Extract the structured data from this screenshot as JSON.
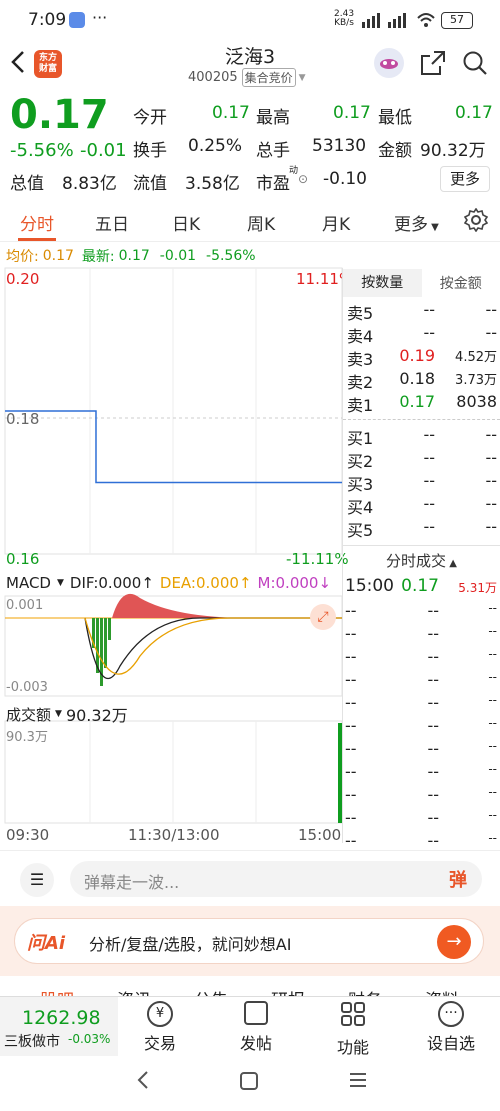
{
  "status_bar": {
    "time": "7:09",
    "net_speed_top": "2.43",
    "net_speed_bottom": "KB/s",
    "battery": "57",
    "dots": "···"
  },
  "header": {
    "logo_line1": "东方",
    "logo_line2": "财富",
    "title": "泛海3",
    "code": "400205",
    "mode": "集合竞价"
  },
  "quote": {
    "price": "0.17",
    "change_pct": "-5.56%",
    "change": "-0.01",
    "open_label": "今开",
    "open": "0.17",
    "high_label": "最高",
    "high": "0.17",
    "low_label": "最低",
    "low": "0.17",
    "turnover_label": "换手",
    "turnover": "0.25%",
    "volume_label": "总手",
    "volume": "53130",
    "amount_label": "金额",
    "amount": "90.32万",
    "mktcap_label": "总值",
    "mktcap": "8.83亿",
    "float_label": "流值",
    "float": "3.58亿",
    "pe_label": "市盈",
    "pe_sup": "动",
    "pe": "-0.10",
    "more": "更多"
  },
  "tabs": [
    "分时",
    "五日",
    "日K",
    "周K",
    "月K",
    "更多"
  ],
  "tab_settings_icon": "gear-icon",
  "info_line": {
    "avg_label": "均价:",
    "avg": "0.17",
    "latest_label": "最新:",
    "latest": "0.17",
    "change": "-0.01",
    "change_pct": "-5.56%"
  },
  "chart_data": [
    {
      "type": "line",
      "title": "分时",
      "y_top_label": "0.20",
      "y_top_pct": "11.11%",
      "y_mid_label": "0.18",
      "y_bottom_label": "0.16",
      "y_bottom_pct": "-11.11%",
      "ylim": [
        0.16,
        0.2
      ],
      "x_labels": [
        "09:30",
        "11:30/13:00",
        "15:00"
      ],
      "series": [
        {
          "values": [
            [
              0,
              0.18
            ],
            [
              0.27,
              0.18
            ],
            [
              0.27,
              0.17
            ],
            [
              1.0,
              0.17
            ]
          ],
          "color": "#2f6fd6"
        }
      ]
    },
    {
      "type": "bar",
      "title": "MACD",
      "dif": "DIF:0.000",
      "dea": "DEA:0.000",
      "m": "M:0.000",
      "y_top": "0.001",
      "y_bottom": "-0.003",
      "ylim": [
        -0.003,
        0.001
      ]
    },
    {
      "type": "bar",
      "title": "成交额",
      "value_label": "90.32万",
      "y_top": "90.3万",
      "bars": [
        {
          "x": 1.0,
          "value": 90.32,
          "color": "#0f9d1f"
        }
      ]
    }
  ],
  "orderbook": {
    "tab_qty": "按数量",
    "tab_amt": "按金额",
    "asks": [
      {
        "label": "卖5",
        "price": "--",
        "vol": "--"
      },
      {
        "label": "卖4",
        "price": "--",
        "vol": "--"
      },
      {
        "label": "卖3",
        "price": "0.19",
        "vol": "4.52万"
      },
      {
        "label": "卖2",
        "price": "0.18",
        "vol": "3.73万"
      },
      {
        "label": "卖1",
        "price": "0.17",
        "vol": "8038"
      }
    ],
    "bids": [
      {
        "label": "买1",
        "price": "--",
        "vol": "--"
      },
      {
        "label": "买2",
        "price": "--",
        "vol": "--"
      },
      {
        "label": "买3",
        "price": "--",
        "vol": "--"
      },
      {
        "label": "买4",
        "price": "--",
        "vol": "--"
      },
      {
        "label": "买5",
        "price": "--",
        "vol": "--"
      }
    ]
  },
  "ticks": {
    "title": "分时成交",
    "rows": [
      {
        "time": "15:00",
        "price": "0.17",
        "vol": "5.31万"
      },
      {
        "time": "--",
        "price": "--",
        "vol": "--"
      },
      {
        "time": "--",
        "price": "--",
        "vol": "--"
      },
      {
        "time": "--",
        "price": "--",
        "vol": "--"
      },
      {
        "time": "--",
        "price": "--",
        "vol": "--"
      },
      {
        "time": "--",
        "price": "--",
        "vol": "--"
      },
      {
        "time": "--",
        "price": "--",
        "vol": "--"
      },
      {
        "time": "--",
        "price": "--",
        "vol": "--"
      },
      {
        "time": "--",
        "price": "--",
        "vol": "--"
      },
      {
        "time": "--",
        "price": "--",
        "vol": "--"
      },
      {
        "time": "--",
        "price": "--",
        "vol": "--"
      },
      {
        "time": "--",
        "price": "--",
        "vol": "--"
      }
    ]
  },
  "danmu": {
    "placeholder": "弹幕走一波...",
    "button": "弹"
  },
  "ai_banner": {
    "brand": "问Ai",
    "text": "分析/复盘/选股，就问妙想AI"
  },
  "sub_tabs": [
    "股吧",
    "资讯",
    "公告",
    "研报",
    "财务",
    "资料"
  ],
  "bottom_bar": {
    "index_value": "1262.98",
    "index_name": "三板做市",
    "index_change": "-0.03%",
    "items": [
      "交易",
      "发帖",
      "功能",
      "设自选"
    ]
  }
}
